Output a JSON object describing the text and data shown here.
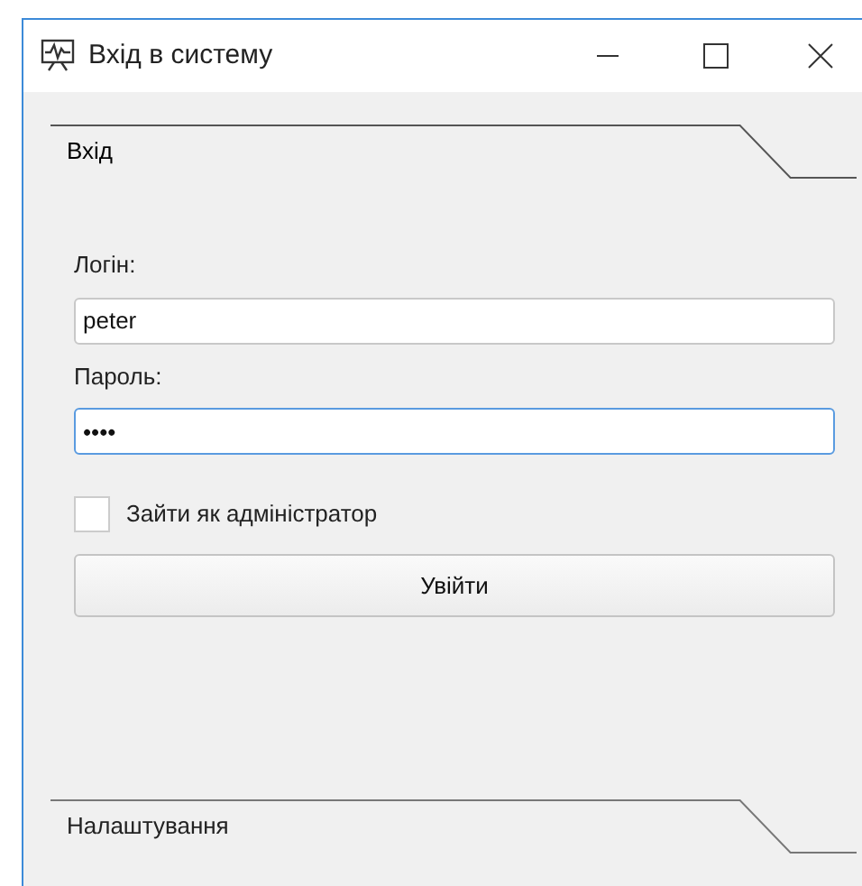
{
  "window": {
    "title": "Вхід в систему"
  },
  "pages": [
    {
      "label": "Вхід",
      "expanded": true
    },
    {
      "label": "Налаштування",
      "expanded": false
    }
  ],
  "fields": [
    {
      "label": "Логін:",
      "value": "peter",
      "focused": false
    },
    {
      "label": "Пароль:",
      "value": "••••",
      "focused": true
    }
  ],
  "admin_checkbox": {
    "label": "Зайти як адміністратор",
    "checked": false
  },
  "login_button": {
    "label": "Увійти"
  }
}
